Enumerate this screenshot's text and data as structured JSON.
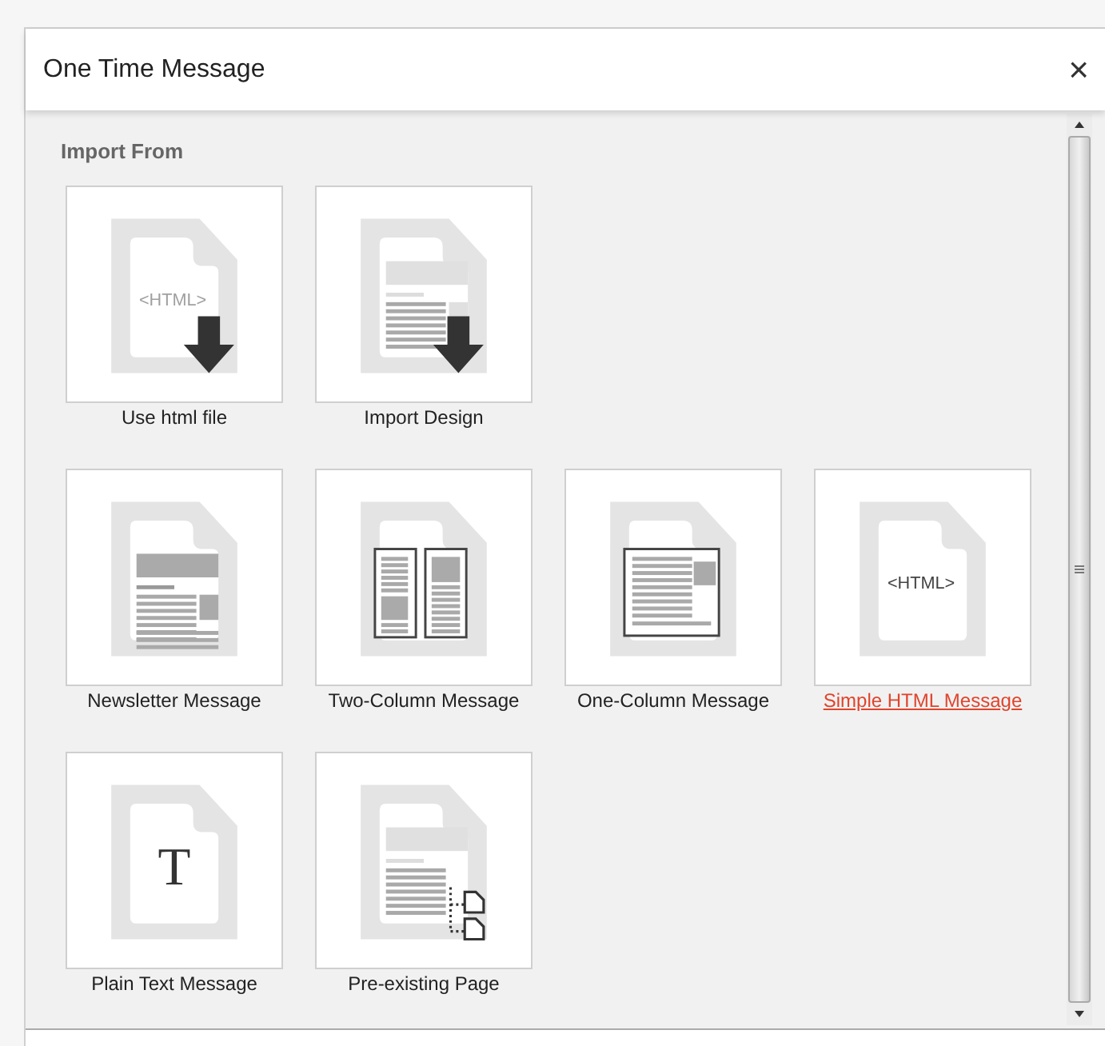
{
  "dialog": {
    "title": "One Time Message",
    "close": "×"
  },
  "section": {
    "heading": "Import From"
  },
  "rows": [
    {
      "items": [
        {
          "kind": "html-file",
          "label": "Use html file",
          "badge": "<HTML>",
          "selected": false
        },
        {
          "kind": "design",
          "label": "Import Design",
          "selected": false
        }
      ]
    },
    {
      "items": [
        {
          "kind": "newsletter",
          "label": "Newsletter Message",
          "selected": false
        },
        {
          "kind": "two-column",
          "label": "Two-Column Message",
          "selected": false
        },
        {
          "kind": "one-column",
          "label": "One-Column Message",
          "selected": false
        },
        {
          "kind": "simple-html",
          "label": "Simple HTML Message",
          "badge": "<HTML>",
          "selected": true
        }
      ]
    },
    {
      "items": [
        {
          "kind": "plain-text",
          "label": "Plain Text Message",
          "badge": "T",
          "selected": false
        },
        {
          "kind": "pre-existing",
          "label": "Pre-existing Page",
          "selected": false
        }
      ]
    }
  ]
}
